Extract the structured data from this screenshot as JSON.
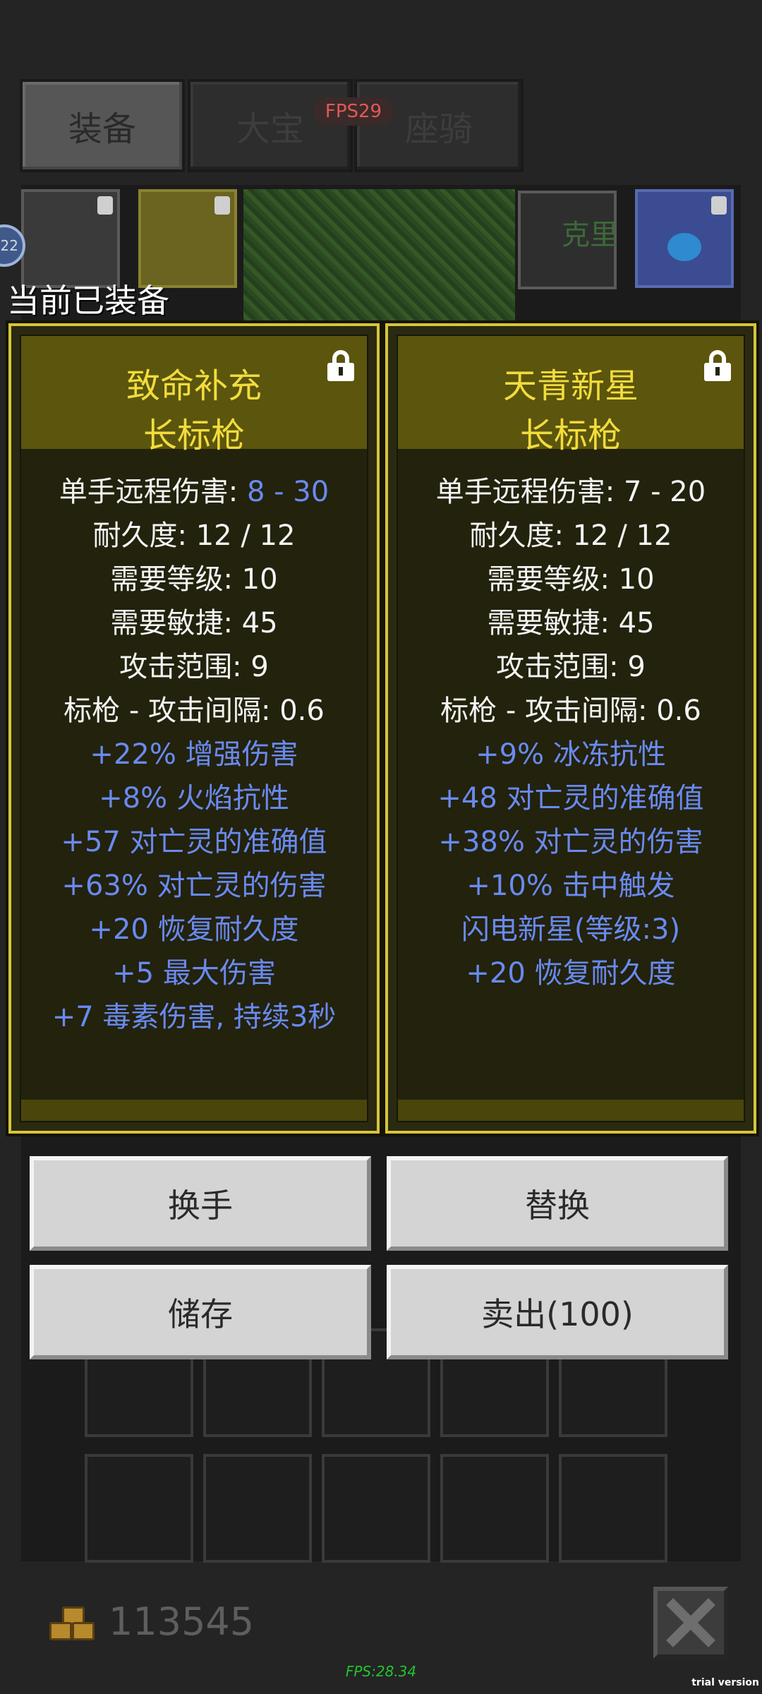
{
  "tabs": [
    {
      "label": "装备",
      "active": true
    },
    {
      "label": "大宝",
      "active": false
    },
    {
      "label": "座骑",
      "active": false
    }
  ],
  "fps_badge": "FPS29",
  "avatar_level": "22",
  "partial_label": "克里",
  "equipped_label": "当前已装备",
  "cards": [
    {
      "title": "致命补充",
      "subtitle": "长标枪",
      "stats": {
        "damage_label": "单手远程伤害: ",
        "damage_value": "8 - 30",
        "durability": "耐久度: 12 / 12",
        "level": "需要等级: 10",
        "dex": "需要敏捷: 45",
        "range": "攻击范围: 9",
        "interval": "标枪 - 攻击间隔: 0.6"
      },
      "affixes": [
        "+22% 增强伤害",
        "+8% 火焰抗性",
        "+57 对亡灵的准确值",
        "+63% 对亡灵的伤害",
        "+20 恢复耐久度",
        "+5 最大伤害",
        "+7 毒素伤害, 持续3秒"
      ]
    },
    {
      "title": "天青新星",
      "subtitle": "长标枪",
      "stats": {
        "damage": "单手远程伤害: 7 - 20",
        "durability": "耐久度: 12 / 12",
        "level": "需要等级: 10",
        "dex": "需要敏捷: 45",
        "range": "攻击范围: 9",
        "interval": "标枪 - 攻击间隔: 0.6"
      },
      "affixes": [
        "+9% 冰冻抗性",
        "+48 对亡灵的准确值",
        "+38% 对亡灵的伤害",
        "+10% 击中触发",
        "闪电新星(等级:3)",
        "+20 恢复耐久度"
      ]
    }
  ],
  "actions": {
    "swap_hand": "换手",
    "replace": "替换",
    "store": "储存",
    "sell": "卖出(100)"
  },
  "gold": "113545",
  "fps_bottom": "FPS:28.34",
  "trial": "trial version",
  "colors": {
    "title_yellow": "#f2dc3d",
    "affix_blue": "#6a8af0",
    "card_border": "#d8c43a"
  }
}
